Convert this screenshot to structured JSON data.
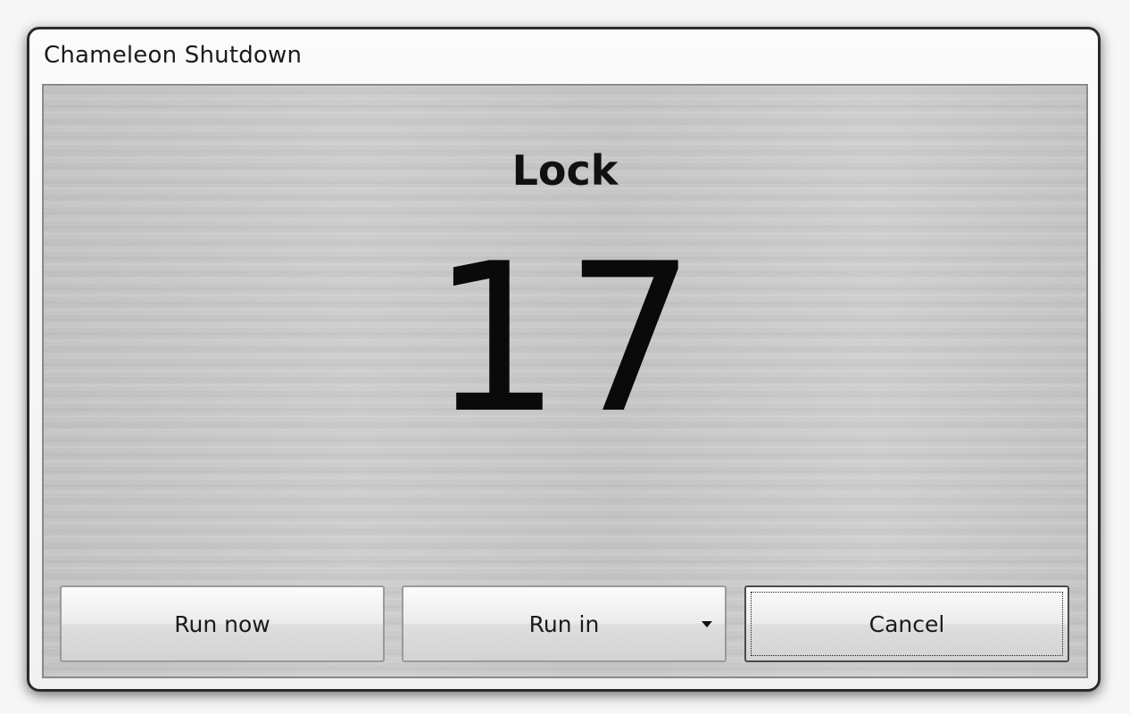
{
  "window": {
    "title": "Chameleon Shutdown"
  },
  "main": {
    "action": "Lock",
    "countdown": "17"
  },
  "buttons": {
    "run_now": "Run now",
    "run_in": "Run in",
    "cancel": "Cancel"
  },
  "icons": {
    "run_in_dropdown": "chevron-down-icon"
  }
}
